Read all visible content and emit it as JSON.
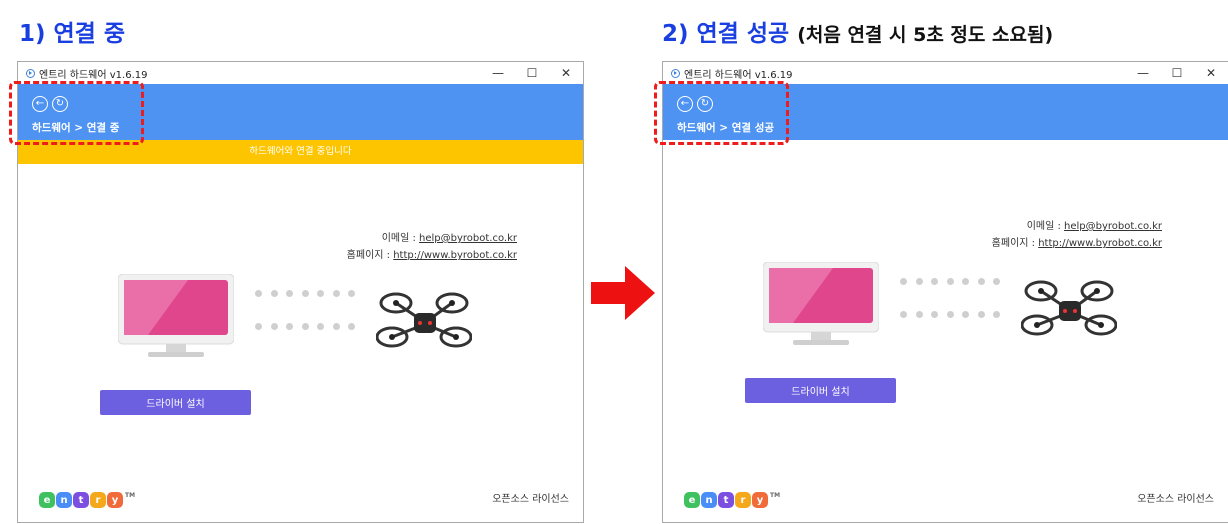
{
  "panels": [
    {
      "heading": "1) 연결 중",
      "heading_sub": "",
      "window_title": "엔트리 하드웨어 v1.6.19",
      "breadcrumb_hw": "하드웨어",
      "breadcrumb_sep": ">",
      "breadcrumb_status": "연결 중",
      "notice": "하드웨어와 연결 중입니다",
      "email_label": "이메일 : ",
      "email": "help@byrobot.co.kr",
      "homepage_label": "홈페이지 : ",
      "homepage": "http://www.byrobot.co.kr",
      "driver_button": "드라이버 설치",
      "license": "오픈소스 라이선스"
    },
    {
      "heading": "2) 연결 성공",
      "heading_sub": "(처음 연결 시 5초 정도 소요됨)",
      "window_title": "엔트리 하드웨어 v1.6.19",
      "breadcrumb_hw": "하드웨어",
      "breadcrumb_sep": ">",
      "breadcrumb_status": "연결 성공",
      "email_label": "이메일 : ",
      "email": "help@byrobot.co.kr",
      "homepage_label": "홈페이지 : ",
      "homepage": "http://www.byrobot.co.kr",
      "driver_button": "드라이버 설치",
      "license": "오픈소스 라이선스"
    }
  ],
  "window_controls": {
    "minimize": "—",
    "maximize": "☐",
    "close": "✕"
  },
  "nav_icons": {
    "back": "back-arrow-icon",
    "refresh": "refresh-icon"
  },
  "entry_logo": {
    "letters": [
      "e",
      "n",
      "t",
      "r",
      "y"
    ],
    "trademark": "TM"
  },
  "colors": {
    "heading": "#1a3fe0",
    "header_bar": "#4f93f2",
    "notice_bar": "#fdc500",
    "driver_button": "#6c5fe0",
    "highlight_dash": "#ee1c1c",
    "arrow": "#ee1111",
    "entry_logo": [
      "#3ec15e",
      "#4b8df7",
      "#7b4fe0",
      "#f5a91a",
      "#f06a3a"
    ]
  }
}
